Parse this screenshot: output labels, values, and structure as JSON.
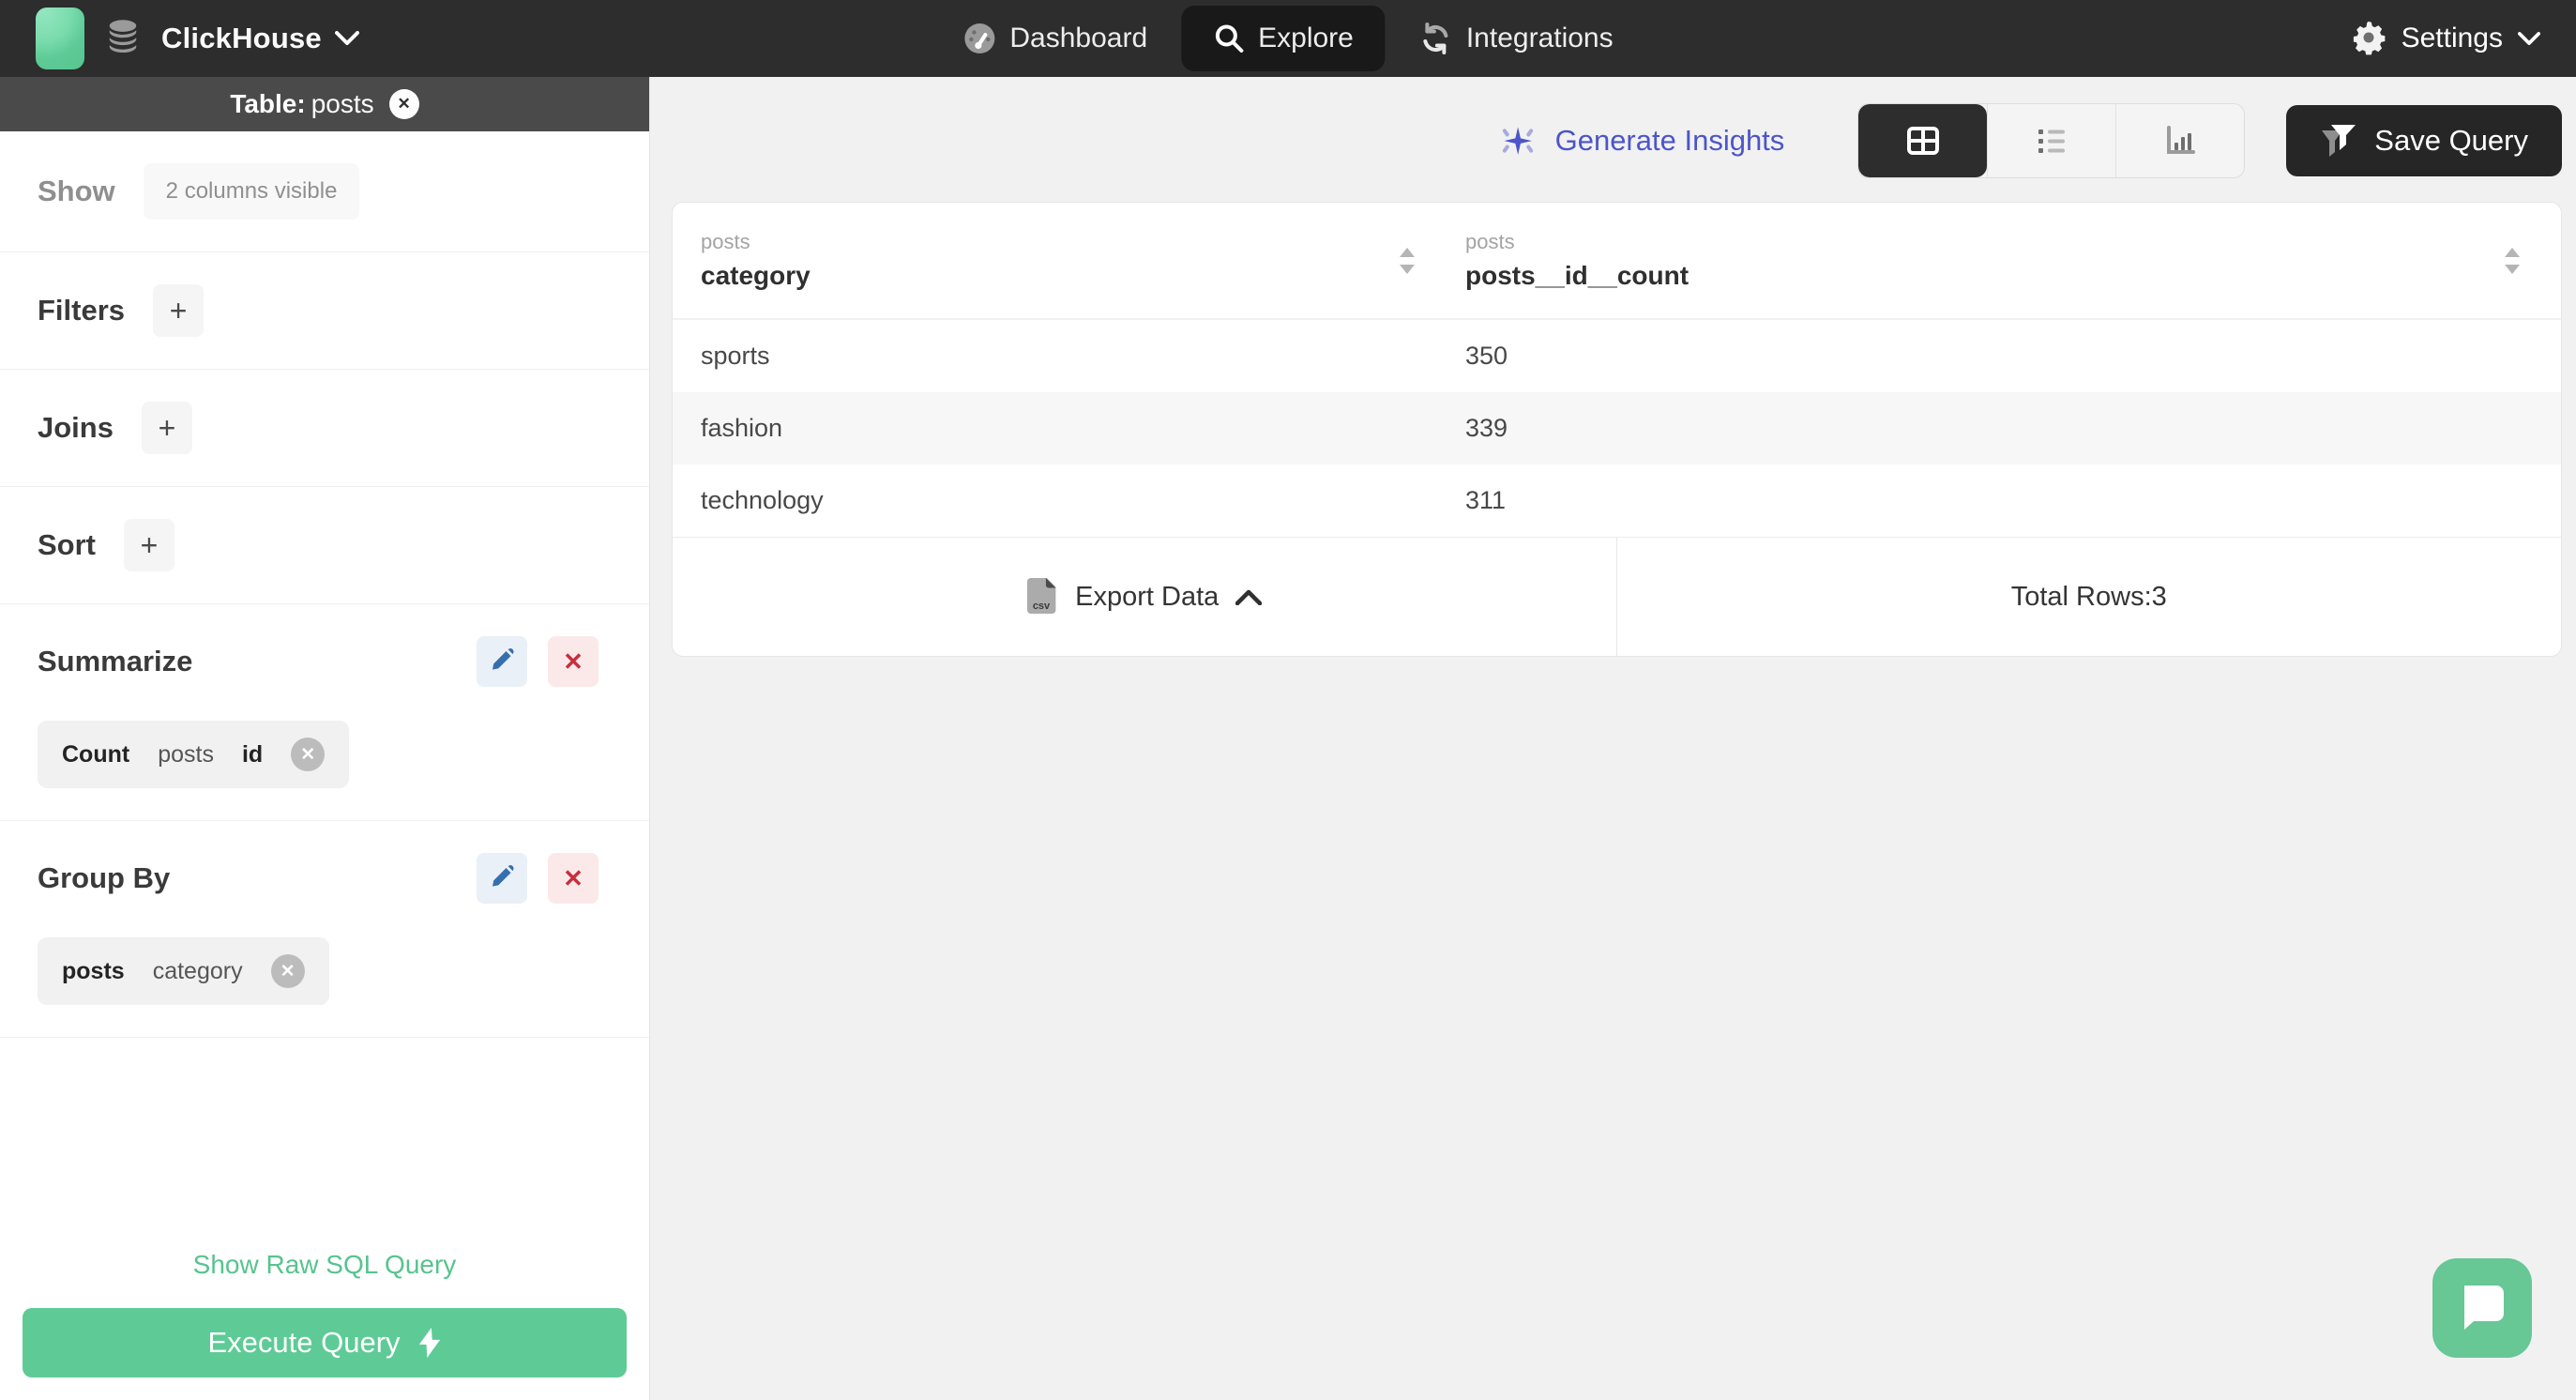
{
  "nav": {
    "brand": {
      "name": "ClickHouse"
    },
    "items": [
      {
        "label": "Dashboard",
        "active": false
      },
      {
        "label": "Explore",
        "active": true
      },
      {
        "label": "Integrations",
        "active": false
      }
    ],
    "settings_label": "Settings"
  },
  "sidebar": {
    "table_header": {
      "prefix": "Table:",
      "table_name": "posts"
    },
    "show": {
      "label": "Show",
      "badge": "2 columns visible"
    },
    "filters": {
      "label": "Filters",
      "add_label": "+"
    },
    "joins": {
      "label": "Joins",
      "add_label": "+"
    },
    "sort": {
      "label": "Sort",
      "add_label": "+"
    },
    "summarize": {
      "label": "Summarize",
      "delete_label": "✕",
      "chip": {
        "aggregate": "Count",
        "table": "posts",
        "field": "id",
        "remove_label": "✕"
      }
    },
    "group_by": {
      "label": "Group By",
      "delete_label": "✕",
      "chip": {
        "table": "posts",
        "field": "category",
        "remove_label": "✕"
      }
    },
    "raw_sql_link": "Show Raw SQL Query",
    "execute_button": "Execute Query",
    "close_label": "✕"
  },
  "main": {
    "generate_insights": "Generate Insights",
    "save_query": "Save Query",
    "table": {
      "columns": [
        {
          "table": "posts",
          "name": "category"
        },
        {
          "table": "posts",
          "name": "posts__id__count"
        }
      ],
      "rows": [
        {
          "category": "sports",
          "count": "350"
        },
        {
          "category": "fashion",
          "count": "339"
        },
        {
          "category": "technology",
          "count": "311"
        }
      ],
      "export_label": "Export Data",
      "total_rows_label": "Total Rows:3"
    }
  },
  "colors": {
    "accent_green": "#5ecb97",
    "accent_indigo": "#4c55c9",
    "nav_background": "#2d2d2d",
    "table_bar_background": "#4a4a4a",
    "edit_blue": "#366fb0",
    "delete_red": "#c62f3d",
    "main_background": "#f1f1f1"
  }
}
